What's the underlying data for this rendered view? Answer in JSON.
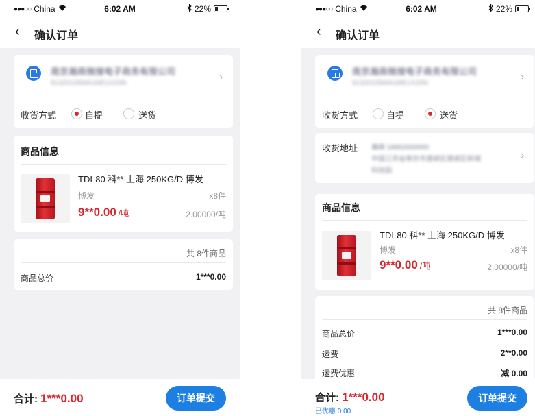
{
  "status_bar": {
    "carrier": "China",
    "time": "6:02 AM",
    "battery": "22%",
    "battery_level": 0.22
  },
  "nav": {
    "title": "确认订单",
    "back_icon": "chevron-left-icon"
  },
  "left_screen": {
    "company": {
      "name_blurred": "南京瀚商微搜电子商务有限公司",
      "tax_id_blurred": "91320105MA1ME1X20N"
    },
    "delivery": {
      "label": "收货方式",
      "option_pickup": "自提",
      "option_delivery": "送货",
      "selected": "自提"
    },
    "product_section_title": "商品信息",
    "product": {
      "name": "TDI-80 科** 上海 250KG/D 博发",
      "brand": "博发",
      "qty": "x8件",
      "price": "9**0.00",
      "price_unit": "/吨",
      "unit_price": "2.00000/吨"
    },
    "summary": {
      "count": "共 8件商品",
      "total_label": "商品总价",
      "total_value": "1***0.00"
    },
    "bottom": {
      "total_label": "合计:",
      "total_value": "1***0.00",
      "submit": "订单提交"
    }
  },
  "right_screen": {
    "company": {
      "name_blurred": "南京瀚商微搜电子商务有限公司",
      "tax_id_blurred": "91320105MA1ME1X20N"
    },
    "delivery": {
      "label": "收货方式",
      "option_pickup": "自提",
      "option_delivery": "送货",
      "selected": "送货"
    },
    "address": {
      "label": "收货地址",
      "contact_blurred": "瀚商 18952000000",
      "line1_blurred": "中国江苏省南京市建邺区建邺区新城",
      "line2_blurred": "科技园"
    },
    "product_section_title": "商品信息",
    "product": {
      "name": "TDI-80 科** 上海 250KG/D 博发",
      "brand": "博发",
      "qty": "x8件",
      "price": "9**0.00",
      "price_unit": "/吨",
      "unit_price": "2.00000/吨"
    },
    "summary": {
      "count": "共 8件商品",
      "rows": [
        {
          "label": "商品总价",
          "value": "1***0.00"
        },
        {
          "label": "运费",
          "value": "2**0.00"
        },
        {
          "label": "运费优惠",
          "value": "减 0.00"
        }
      ]
    },
    "bottom": {
      "total_label": "合计:",
      "total_value": "1***0.00",
      "discount": "已优惠 0.00",
      "submit": "订单提交"
    }
  },
  "colors": {
    "accent_blue": "#1e7fe3",
    "price_red": "#d7262e",
    "page_bg": "#f1f1f3"
  }
}
